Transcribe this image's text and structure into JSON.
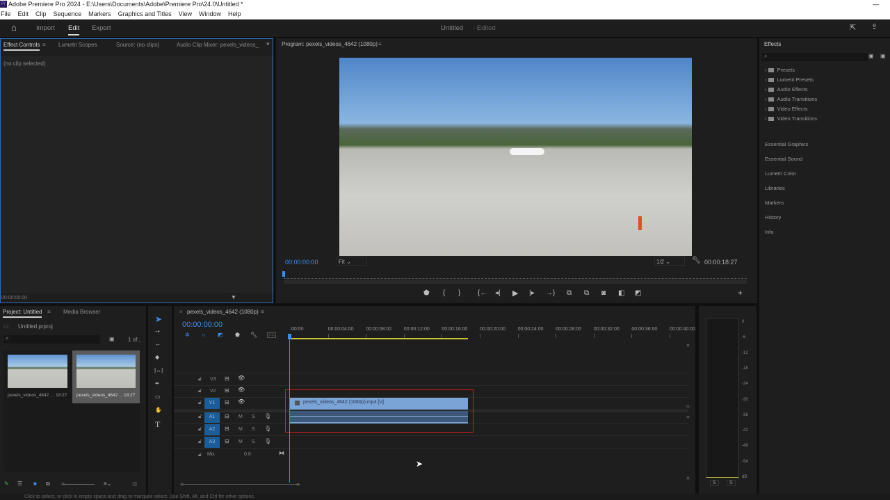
{
  "window": {
    "title": "Adobe Premiere Pro 2024 - E:\\Users\\Documents\\Adobe\\Premiere Pro\\24.0\\Untitled *",
    "logo": "Pr"
  },
  "menu": [
    "File",
    "Edit",
    "Clip",
    "Sequence",
    "Markers",
    "Graphics and Titles",
    "View",
    "Window",
    "Help"
  ],
  "header": {
    "tabs": [
      "Import",
      "Edit",
      "Export"
    ],
    "project_name": "Untitled",
    "status": "- Edited"
  },
  "effect_controls": {
    "tabs": [
      "Effect Controls",
      "Lumetri Scopes",
      "Source: (no clips)",
      "Audio Clip Mixer: pexels_videos_"
    ],
    "message": "(no clip selected)",
    "timecode": "00:00:00:00"
  },
  "program": {
    "title": "Program: pexels_videos_4642 (1080p)",
    "timecode": "00:00:00:00",
    "fit": "Fit",
    "resolution": "1/2",
    "duration": "00:00:18:27"
  },
  "effects": {
    "title": "Effects",
    "folders": [
      "Presets",
      "Lumetri Presets",
      "Audio Effects",
      "Audio Transitions",
      "Video Effects",
      "Video Transitions"
    ],
    "panels": [
      "Essential Graphics",
      "Essential Sound",
      "Lumetri Color",
      "Libraries",
      "Markers",
      "History",
      "Info"
    ]
  },
  "project": {
    "tabs": [
      "Project: Untitled",
      "Media Browser"
    ],
    "file": "Untitled.prproj",
    "count": "1 of..",
    "items": [
      {
        "name": "pexels_videos_4642 ...",
        "duration": "18:27"
      },
      {
        "name": "pexels_videos_4642 ...",
        "duration": "18:27"
      }
    ]
  },
  "timeline": {
    "title": "pexels_videos_4642 (1080p)",
    "timecode": "00:00:00:00",
    "ruler": [
      ":00:00",
      "00:00:04:00",
      "00:00:08:00",
      "00:00:12:00",
      "00:00:16:00",
      "00:00:20:00",
      "00:00:24:00",
      "00:00:28:00",
      "00:00:32:00",
      "00:00:36:00",
      "00:00:40:00"
    ],
    "tracks": [
      {
        "name": "V3"
      },
      {
        "name": "V2"
      },
      {
        "name": "V1"
      },
      {
        "name": "A1"
      },
      {
        "name": "A2"
      },
      {
        "name": "A3"
      }
    ],
    "mix_label": "Mix",
    "mix_value": "0.0",
    "clip_label": "pexels_videos_4642 (1080p).mp4 [V]",
    "m": "M",
    "s": "S"
  },
  "meter": {
    "scale": [
      "0",
      "-6",
      "-12",
      "-18",
      "-24",
      "-30",
      "-36",
      "-42",
      "-48",
      "-54",
      "dB"
    ],
    "solo": [
      "S",
      "S"
    ]
  },
  "status": "Click to select, or click in empty space and drag to marquee select. Use Shift, Alt, and Ctrl for other options.",
  "colors": {
    "accent": "#3d8ee8",
    "clip_video": "#7aa3d6",
    "selection": "#d42020"
  }
}
